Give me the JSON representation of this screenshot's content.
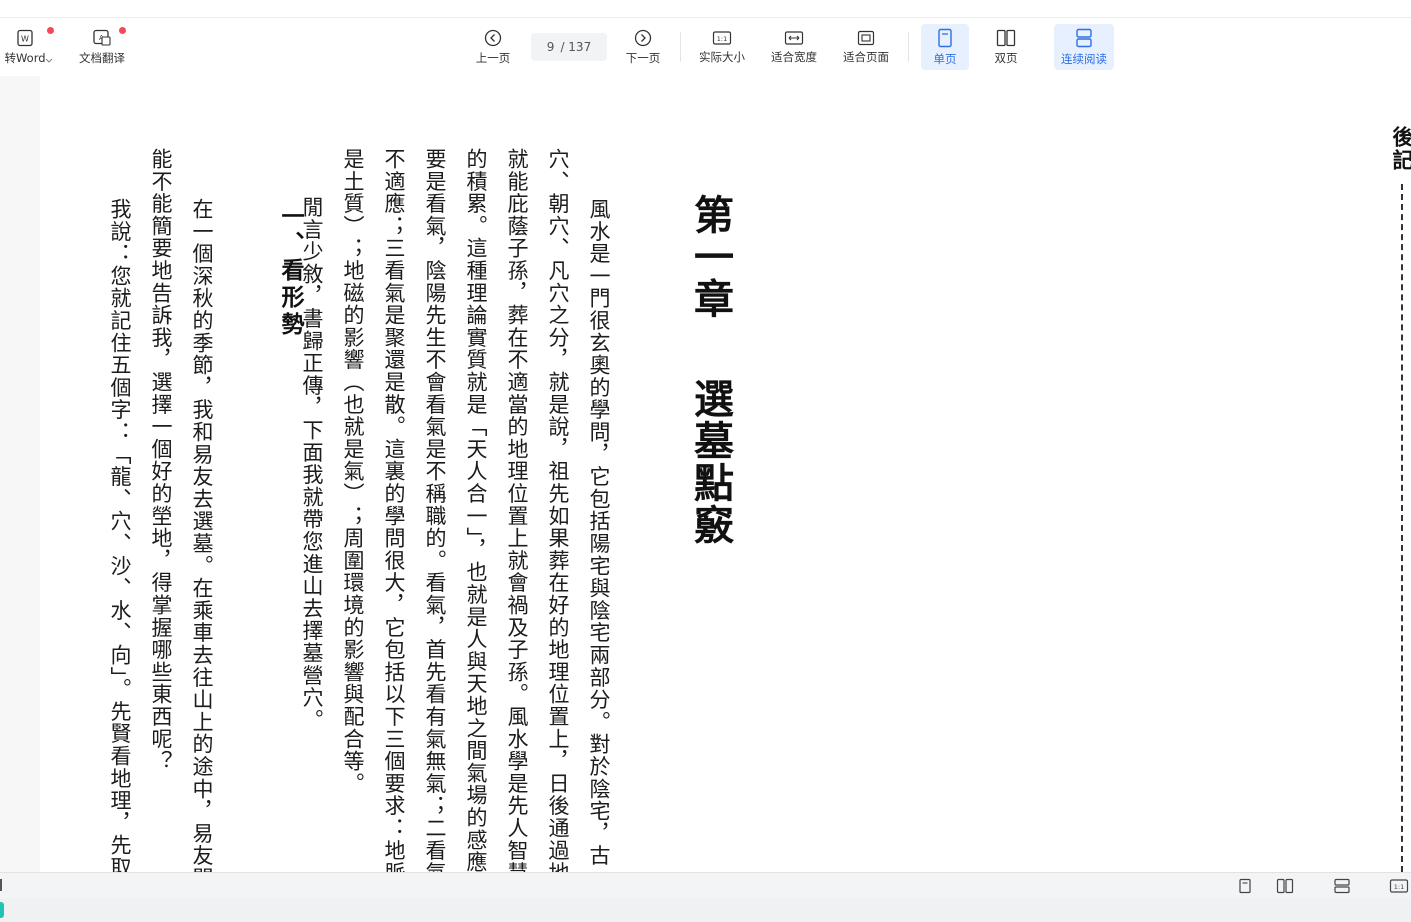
{
  "toolbar": {
    "to_word": "转Word",
    "doc_translate": "文档翻译",
    "prev_page": "上一页",
    "page_current": "9",
    "page_total": "/ 137",
    "next_page": "下一页",
    "actual_size": "实际大小",
    "fit_width": "适合宽度",
    "fit_page": "适合页面",
    "single_page": "单页",
    "double_page": "双页",
    "continuous_read": "连续阅读",
    "actual_size_icon_text": "1:1"
  },
  "document": {
    "chapter_title_part1": "第一章",
    "chapter_title_part2": "選墓點竅",
    "columns": [
      "風水是一門很玄奧的學問，它包括陽宅與陰宅兩部分。對於陰宅，古",
      "穴、朝穴、凡穴之分，就是說，祖先如果葬在好的地理位置上，日後通過地",
      "就能庇蔭子孫，葬在不適當的地理位置上就會禍及子孫。風水學是先人智慧",
      "的積累。這種理論實質就是「天人合一」，也就是人與天地之間氣場的感應",
      "要是看氣，陰陽先生不會看氣是不稱職的。看氣，首先看有氣無氣；二看氣",
      "不適應；三看氣是聚還是散。這裏的學問很大，它包括以下三個要求：地脈",
      "是土質）；地磁的影響（也就是氣）；周圍環境的影響與配合等。",
      "閒言少敘，書歸正傳，下面我就帶您進山去擇墓營穴。"
    ],
    "section_heading": "一、看形勢",
    "section_columns": [
      "在一個深秋的季節，我和易友去選墓。在乘車去往山上的途中，易友問",
      "能不能簡要地告訴我，選擇一個好的塋地，得掌握哪些東西呢？",
      "我說：您就記住五個字：「龍、穴、沙、水、向」。先賢看地理，先取"
    ],
    "right_page_label": "後記"
  },
  "colors": {
    "accent": "#2f6fe4",
    "active_bg": "#e6f0ff",
    "notify_dot": "#f24a5a"
  }
}
